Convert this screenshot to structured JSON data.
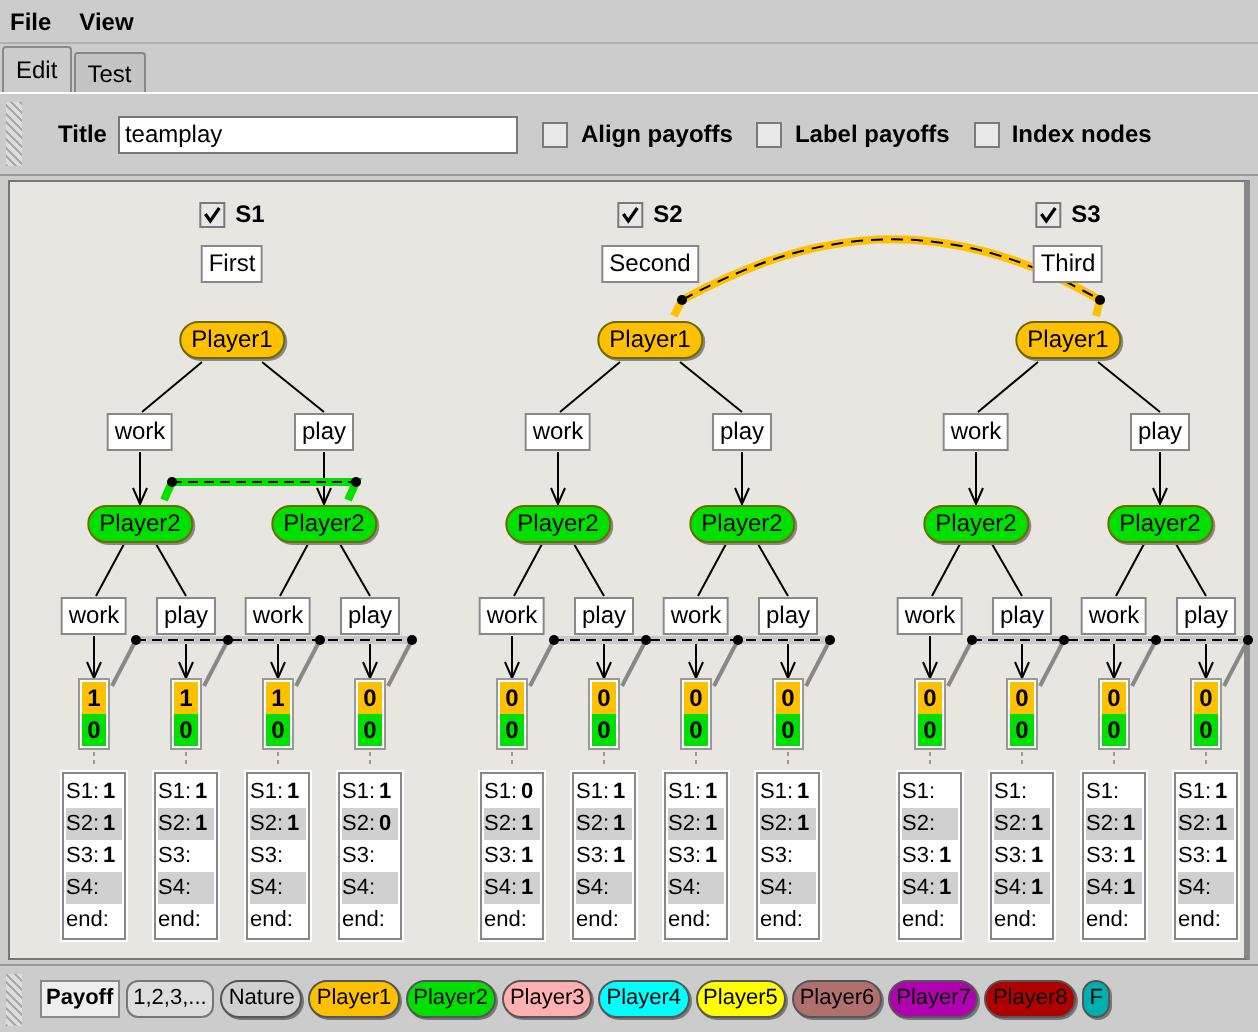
{
  "menu": [
    "File",
    "View"
  ],
  "tabs": [
    {
      "label": "Edit",
      "selected": true
    },
    {
      "label": "Test",
      "selected": false
    }
  ],
  "toolbar": {
    "title_label": "Title",
    "title_value": "teamplay",
    "options": [
      {
        "label": "Align payoffs",
        "checked": false
      },
      {
        "label": "Label payoffs",
        "checked": false
      },
      {
        "label": "Index nodes",
        "checked": false
      }
    ]
  },
  "strategies": [
    {
      "name": "S1",
      "checked": true,
      "label": "First",
      "root": {
        "player": "Player1",
        "color": "#ffc000",
        "moves": [
          {
            "action": "work",
            "node": {
              "player": "Player2",
              "color": "#00e000",
              "moves": [
                {
                  "action": "work",
                  "leaf": {
                    "payoffs": [
                      "1",
                      "0"
                    ],
                    "outcomes": [
                      {
                        "label": "S1:",
                        "value": "1"
                      },
                      {
                        "label": "S2:",
                        "value": "1"
                      },
                      {
                        "label": "S3:",
                        "value": "1"
                      },
                      {
                        "label": "S4:"
                      },
                      {
                        "label": "end:"
                      }
                    ]
                  }
                },
                {
                  "action": "play",
                  "leaf": {
                    "payoffs": [
                      "1",
                      "0"
                    ],
                    "outcomes": [
                      {
                        "label": "S1:",
                        "value": "1"
                      },
                      {
                        "label": "S2:",
                        "value": "1"
                      },
                      {
                        "label": "S3:"
                      },
                      {
                        "label": "S4:"
                      },
                      {
                        "label": "end:"
                      }
                    ]
                  }
                }
              ]
            }
          },
          {
            "action": "play",
            "node": {
              "player": "Player2",
              "color": "#00e000",
              "moves": [
                {
                  "action": "work",
                  "leaf": {
                    "payoffs": [
                      "1",
                      "0"
                    ],
                    "outcomes": [
                      {
                        "label": "S1:",
                        "value": "1"
                      },
                      {
                        "label": "S2:",
                        "value": "1"
                      },
                      {
                        "label": "S3:"
                      },
                      {
                        "label": "S4:"
                      },
                      {
                        "label": "end:"
                      }
                    ]
                  }
                },
                {
                  "action": "play",
                  "leaf": {
                    "payoffs": [
                      "0",
                      "0"
                    ],
                    "outcomes": [
                      {
                        "label": "S1:",
                        "value": "1"
                      },
                      {
                        "label": "S2:",
                        "value": "0"
                      },
                      {
                        "label": "S3:"
                      },
                      {
                        "label": "S4:"
                      },
                      {
                        "label": "end:"
                      }
                    ]
                  }
                }
              ]
            }
          }
        ]
      }
    },
    {
      "name": "S2",
      "checked": true,
      "label": "Second",
      "root": {
        "player": "Player1",
        "color": "#ffc000",
        "moves": [
          {
            "action": "work",
            "node": {
              "player": "Player2",
              "color": "#00e000",
              "moves": [
                {
                  "action": "work",
                  "leaf": {
                    "payoffs": [
                      "0",
                      "0"
                    ],
                    "outcomes": [
                      {
                        "label": "S1:",
                        "value": "0"
                      },
                      {
                        "label": "S2:",
                        "value": "1"
                      },
                      {
                        "label": "S3:",
                        "value": "1"
                      },
                      {
                        "label": "S4:",
                        "value": "1"
                      },
                      {
                        "label": "end:"
                      }
                    ]
                  }
                },
                {
                  "action": "play",
                  "leaf": {
                    "payoffs": [
                      "0",
                      "0"
                    ],
                    "outcomes": [
                      {
                        "label": "S1:",
                        "value": "1"
                      },
                      {
                        "label": "S2:",
                        "value": "1"
                      },
                      {
                        "label": "S3:",
                        "value": "1"
                      },
                      {
                        "label": "S4:"
                      },
                      {
                        "label": "end:"
                      }
                    ]
                  }
                }
              ]
            }
          },
          {
            "action": "play",
            "node": {
              "player": "Player2",
              "color": "#00e000",
              "moves": [
                {
                  "action": "work",
                  "leaf": {
                    "payoffs": [
                      "0",
                      "0"
                    ],
                    "outcomes": [
                      {
                        "label": "S1:",
                        "value": "1"
                      },
                      {
                        "label": "S2:",
                        "value": "1"
                      },
                      {
                        "label": "S3:",
                        "value": "1"
                      },
                      {
                        "label": "S4:"
                      },
                      {
                        "label": "end:"
                      }
                    ]
                  }
                },
                {
                  "action": "play",
                  "leaf": {
                    "payoffs": [
                      "0",
                      "0"
                    ],
                    "outcomes": [
                      {
                        "label": "S1:",
                        "value": "1"
                      },
                      {
                        "label": "S2:",
                        "value": "1"
                      },
                      {
                        "label": "S3:"
                      },
                      {
                        "label": "S4:"
                      },
                      {
                        "label": "end:"
                      }
                    ]
                  }
                }
              ]
            }
          }
        ]
      }
    },
    {
      "name": "S3",
      "checked": true,
      "label": "Third",
      "root": {
        "player": "Player1",
        "color": "#ffc000",
        "moves": [
          {
            "action": "work",
            "node": {
              "player": "Player2",
              "color": "#00e000",
              "moves": [
                {
                  "action": "work",
                  "leaf": {
                    "payoffs": [
                      "0",
                      "0"
                    ],
                    "outcomes": [
                      {
                        "label": "S1:"
                      },
                      {
                        "label": "S2:"
                      },
                      {
                        "label": "S3:",
                        "value": "1"
                      },
                      {
                        "label": "S4:",
                        "value": "1"
                      },
                      {
                        "label": "end:"
                      }
                    ]
                  }
                },
                {
                  "action": "play",
                  "leaf": {
                    "payoffs": [
                      "0",
                      "0"
                    ],
                    "outcomes": [
                      {
                        "label": "S1:"
                      },
                      {
                        "label": "S2:",
                        "value": "1"
                      },
                      {
                        "label": "S3:",
                        "value": "1"
                      },
                      {
                        "label": "S4:",
                        "value": "1"
                      },
                      {
                        "label": "end:"
                      }
                    ]
                  }
                }
              ]
            }
          },
          {
            "action": "play",
            "node": {
              "player": "Player2",
              "color": "#00e000",
              "moves": [
                {
                  "action": "work",
                  "leaf": {
                    "payoffs": [
                      "0",
                      "0"
                    ],
                    "outcomes": [
                      {
                        "label": "S1:"
                      },
                      {
                        "label": "S2:",
                        "value": "1"
                      },
                      {
                        "label": "S3:",
                        "value": "1"
                      },
                      {
                        "label": "S4:",
                        "value": "1"
                      },
                      {
                        "label": "end:"
                      }
                    ]
                  }
                },
                {
                  "action": "play",
                  "leaf": {
                    "payoffs": [
                      "0",
                      "0"
                    ],
                    "outcomes": [
                      {
                        "label": "S1:",
                        "value": "1"
                      },
                      {
                        "label": "S2:",
                        "value": "1"
                      },
                      {
                        "label": "S3:",
                        "value": "1"
                      },
                      {
                        "label": "S4:"
                      },
                      {
                        "label": "end:"
                      }
                    ]
                  }
                }
              ]
            }
          }
        ]
      }
    }
  ],
  "palette": [
    {
      "label": "Payoff",
      "kind": "payoff"
    },
    {
      "label": "1,2,3,...",
      "kind": "sequence"
    },
    {
      "label": "Nature",
      "kind": "player",
      "color": "#d0d0d0"
    },
    {
      "label": "Player1",
      "kind": "player",
      "color": "#ffc000"
    },
    {
      "label": "Player2",
      "kind": "player",
      "color": "#00e000"
    },
    {
      "label": "Player3",
      "kind": "player",
      "color": "#ffb0b0"
    },
    {
      "label": "Player4",
      "kind": "player",
      "color": "#00ffff"
    },
    {
      "label": "Player5",
      "kind": "player",
      "color": "#ffff00"
    },
    {
      "label": "Player6",
      "kind": "player",
      "color": "#b07070"
    },
    {
      "label": "Player7",
      "kind": "player",
      "color": "#b000b0"
    },
    {
      "label": "Player8",
      "kind": "player",
      "color": "#b00000"
    },
    {
      "label": "F",
      "kind": "player",
      "color": "#00b0b0"
    }
  ]
}
